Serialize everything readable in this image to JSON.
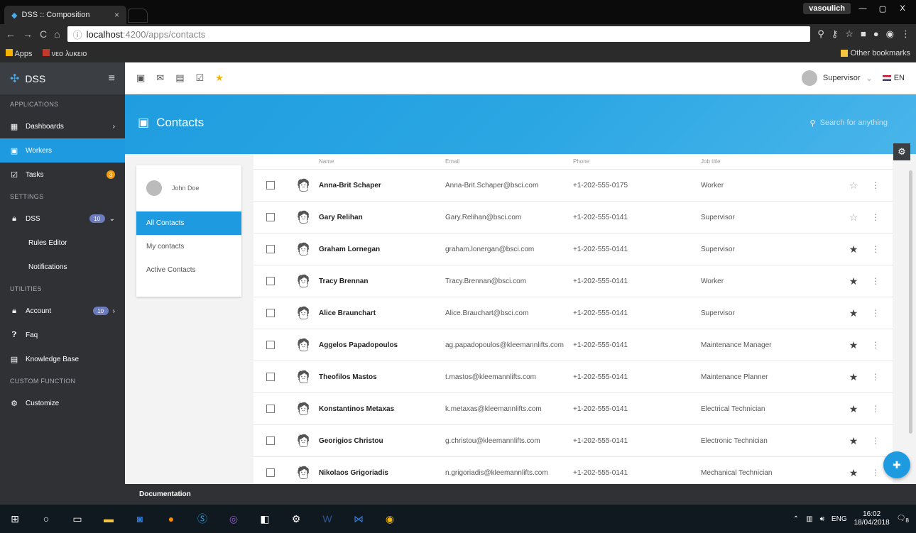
{
  "browser": {
    "tab_title": "DSS :: Composition",
    "tab_close": "×",
    "window_user": "vasoulich",
    "win_min": "—",
    "win_max": "▢",
    "win_close": "X",
    "url_host": "localhost",
    "url_path": ":4200/apps/contacts",
    "bookmarks": [
      "Apps",
      "νεο λυκειο"
    ],
    "other_bookmarks": "Other bookmarks"
  },
  "sidebar": {
    "brand": "DSS",
    "sections": {
      "applications": "APPLICATIONS",
      "settings": "SETTINGS",
      "utilities": "UTILITIES",
      "custom": "CUSTOM FUNCTION"
    },
    "items": {
      "dashboards": "Dashboards",
      "workers": "Workers",
      "tasks": "Tasks",
      "tasks_badge": "3",
      "dss": "DSS",
      "dss_badge": "10",
      "rules_editor": "Rules Editor",
      "notifications": "Notifications",
      "account": "Account",
      "account_badge": "10",
      "faq": "Faq",
      "knowledge_base": "Knowledge Base",
      "customize": "Customize"
    }
  },
  "topbar": {
    "user_role": "Supervisor",
    "language": "EN"
  },
  "hero": {
    "title": "Contacts",
    "search_placeholder": "Search for anything"
  },
  "left_panel": {
    "user": "John Doe",
    "filters": [
      "All Contacts",
      "My contacts",
      "Active Contacts"
    ]
  },
  "table": {
    "headers": [
      "Name",
      "Email",
      "Phone",
      "Job title"
    ],
    "rows": [
      {
        "name": "Anna-Brit Schaper",
        "email": "Anna-Brit.Schaper@bsci.com",
        "phone": "+1-202-555-0175",
        "job": "Worker",
        "starred": false
      },
      {
        "name": "Gary Relihan",
        "email": "Gary.Relihan@bsci.com",
        "phone": "+1-202-555-0141",
        "job": "Supervisor",
        "starred": false
      },
      {
        "name": "Graham Lornegan",
        "email": "graham.lonergan@bsci.com",
        "phone": "+1-202-555-0141",
        "job": "Supervisor",
        "starred": true
      },
      {
        "name": "Tracy Brennan",
        "email": "Tracy.Brennan@bsci.com",
        "phone": "+1-202-555-0141",
        "job": "Worker",
        "starred": true
      },
      {
        "name": "Alice Braunchart",
        "email": "Alice.Brauchart@bsci.com",
        "phone": "+1-202-555-0141",
        "job": "Supervisor",
        "starred": true
      },
      {
        "name": "Aggelos Papadopoulos",
        "email": "ag.papadopoulos@kleemannlifts.com",
        "phone": "+1-202-555-0141",
        "job": "Maintenance Manager",
        "starred": true
      },
      {
        "name": "Theofilos Mastos",
        "email": "t.mastos@kleemannlifts.com",
        "phone": "+1-202-555-0141",
        "job": "Maintenance Planner",
        "starred": true
      },
      {
        "name": "Konstantinos Metaxas",
        "email": "k.metaxas@kleemannlifts.com",
        "phone": "+1-202-555-0141",
        "job": "Electrical Technician",
        "starred": true
      },
      {
        "name": "Georigios Christou",
        "email": "g.christou@kleemannlifts.com",
        "phone": "+1-202-555-0141",
        "job": "Electronic Technician",
        "starred": true
      },
      {
        "name": "Nikolaos Grigoriadis",
        "email": "n.grigoriadis@kleemannlifts.com",
        "phone": "+1-202-555-0141",
        "job": "Mechanical Technician",
        "starred": true
      }
    ]
  },
  "footer": {
    "label": "Documentation"
  },
  "taskbar": {
    "language": "ENG",
    "time": "16:02",
    "date": "18/04/2018",
    "notification_count": "8"
  },
  "colors": {
    "accent": "#1e9be0",
    "sidebar": "#2f3135",
    "badge_orange": "#f39c12"
  }
}
